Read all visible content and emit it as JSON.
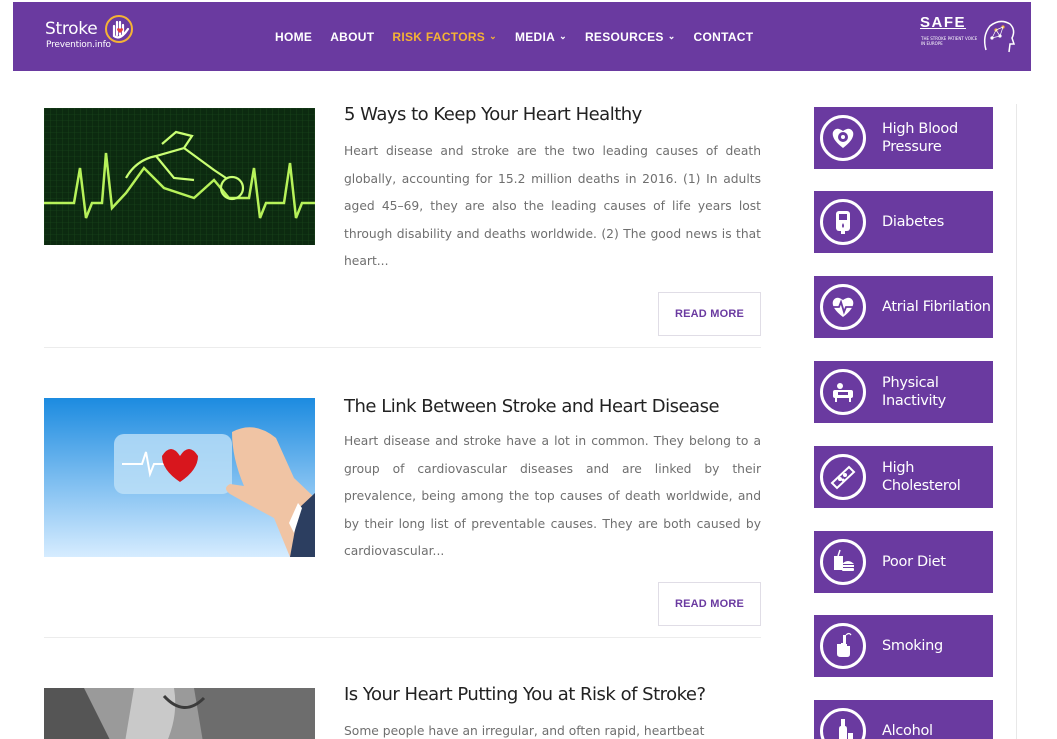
{
  "header": {
    "logo_main": "Stroke",
    "logo_sub": "Prevention.info",
    "nav": [
      {
        "label": "HOME",
        "dropdown": false,
        "active": false
      },
      {
        "label": "ABOUT",
        "dropdown": false,
        "active": false
      },
      {
        "label": "RISK FACTORS",
        "dropdown": true,
        "active": true
      },
      {
        "label": "MEDIA",
        "dropdown": true,
        "active": false
      },
      {
        "label": "RESOURCES",
        "dropdown": true,
        "active": false
      },
      {
        "label": "CONTACT",
        "dropdown": false,
        "active": false
      }
    ],
    "safe_title": "SAFE",
    "safe_sub": "THE STROKE PATIENT VOICE IN EUROPE",
    "caret": "⌄"
  },
  "posts": [
    {
      "title": "5 Ways to Keep Your Heart Healthy",
      "excerpt": "Heart disease and stroke are the two leading causes of death globally, accounting for 15.2 million deaths in 2016. (1) In adults aged 45–69, they are also the leading causes of life years lost through disability and deaths worldwide. (2) The good news is that heart...",
      "read_more": "READ MORE",
      "image_icon": "heartbeat-runner-image"
    },
    {
      "title": "The Link Between Stroke and Heart Disease",
      "excerpt": "Heart disease and stroke have a lot in common. They belong to a group of cardiovascular diseases and are linked by their prevalence, being among the top causes of death worldwide, and by their long list of preventable causes. They are both caused by cardiovascular...",
      "read_more": "READ MORE",
      "image_icon": "hand-holding-heart-card-image"
    },
    {
      "title": "Is Your Heart Putting You at Risk of Stroke?",
      "excerpt": "Some people have an irregular, and often rapid, heartbeat",
      "image_icon": "person-chest-image"
    }
  ],
  "sidebar": {
    "items": [
      {
        "label": "High Blood Pressure",
        "icon": "blood-pressure-icon"
      },
      {
        "label": "Diabetes",
        "icon": "glucose-meter-icon"
      },
      {
        "label": "Atrial Fibrilation",
        "icon": "heart-rhythm-icon"
      },
      {
        "label": "Physical Inactivity",
        "icon": "couch-icon"
      },
      {
        "label": "High Cholesterol",
        "icon": "artery-icon"
      },
      {
        "label": "Poor Diet",
        "icon": "fast-food-icon"
      },
      {
        "label": "Smoking",
        "icon": "cigarette-icon"
      },
      {
        "label": "Alcohol",
        "icon": "bottle-icon"
      }
    ]
  },
  "colors": {
    "brand_purple": "#6a3aa0",
    "nav_active": "#f5b334",
    "text_body": "#6f6f6f"
  }
}
